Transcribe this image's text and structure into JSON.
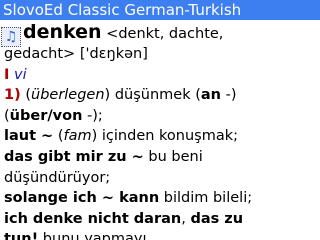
{
  "app": {
    "title": "SlovoEd Classic German-Turkish"
  },
  "entry": {
    "sound_icon": "speaker-note-icon",
    "headword": "denken",
    "forms_line1": "<denkt, dachte,",
    "forms_line2": "gedacht> ['dɛŋkən]",
    "gram_roman": "I",
    "pos": "vi",
    "sense1": {
      "num": "1)",
      "paren_open": "(",
      "note": "überlegen",
      "paren_close": ")",
      "trans": " düşünmek (",
      "prep1": "an",
      "prep1_tail": " -)",
      "line2_open": "(",
      "prep2": "über/von",
      "line2_tail": " -);"
    },
    "examples": [
      {
        "de": "laut ~",
        "mid": " (",
        "label": "fam",
        "tr": ") içinden konuşmak;"
      },
      {
        "de": "das gibt mir zu ~",
        "tr": " bu beni"
      },
      {
        "tr": "düşündürüyor;"
      },
      {
        "de": "solange ich ~ kann",
        "tr": " bildim bileli;"
      },
      {
        "de": "ich denke nicht daran",
        "tr": ", ",
        "de2": "das zu"
      },
      {
        "de": "tun!",
        "tr": " bunu yapmayı"
      }
    ]
  }
}
